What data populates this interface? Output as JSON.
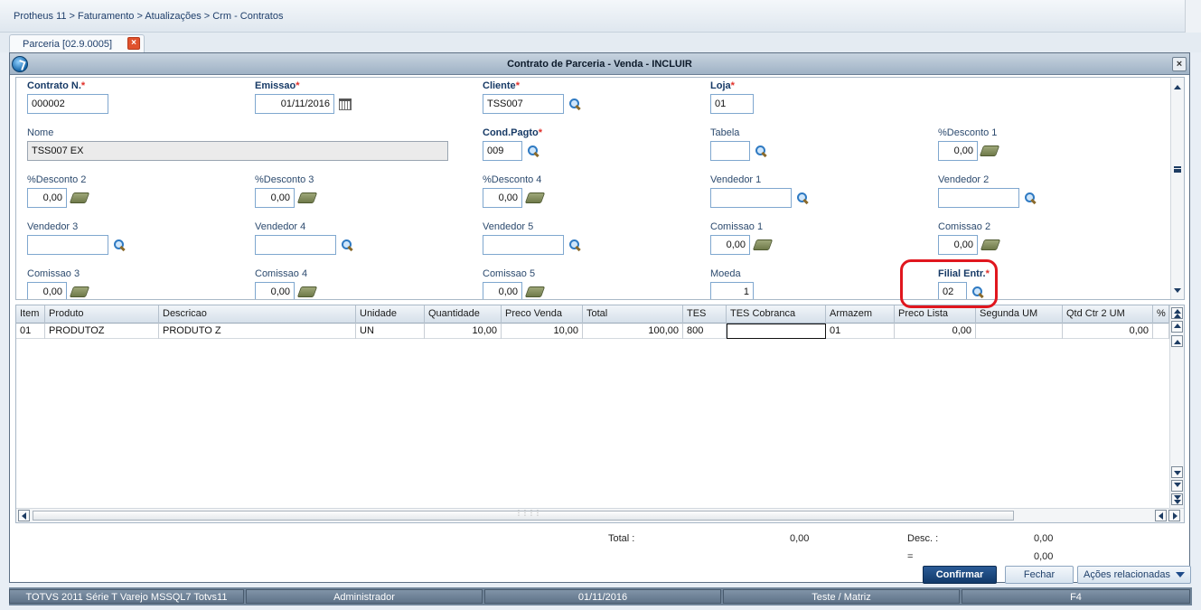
{
  "breadcrumb": "Protheus 11 > Faturamento > Atualizações > Crm - Contratos",
  "tab": {
    "label": "Parceria [02.9.0005]",
    "close": "×"
  },
  "window": {
    "title": "Contrato de Parceria - Venda - INCLUIR",
    "close": "×"
  },
  "form": {
    "contrato": {
      "label": "Contrato N.",
      "value": "000002"
    },
    "emissao": {
      "label": "Emissao",
      "value": "01/11/2016"
    },
    "cliente": {
      "label": "Cliente",
      "value": "TSS007"
    },
    "loja": {
      "label": "Loja",
      "value": "01"
    },
    "nome": {
      "label": "Nome",
      "value": "TSS007 EX"
    },
    "cond_pagto": {
      "label": "Cond.Pagto",
      "value": "009"
    },
    "tabela": {
      "label": "Tabela",
      "value": ""
    },
    "desconto1": {
      "label": "%Desconto 1",
      "value": "0,00"
    },
    "desconto2": {
      "label": "%Desconto 2",
      "value": "0,00"
    },
    "desconto3": {
      "label": "%Desconto 3",
      "value": "0,00"
    },
    "desconto4": {
      "label": "%Desconto 4",
      "value": "0,00"
    },
    "vendedor1": {
      "label": "Vendedor 1",
      "value": ""
    },
    "vendedor2": {
      "label": "Vendedor 2",
      "value": ""
    },
    "vendedor3": {
      "label": "Vendedor 3",
      "value": ""
    },
    "vendedor4": {
      "label": "Vendedor 4",
      "value": ""
    },
    "vendedor5": {
      "label": "Vendedor 5",
      "value": ""
    },
    "comissao1": {
      "label": "Comissao 1",
      "value": "0,00"
    },
    "comissao2": {
      "label": "Comissao 2",
      "value": "0,00"
    },
    "comissao3": {
      "label": "Comissao 3",
      "value": "0,00"
    },
    "comissao4": {
      "label": "Comissao 4",
      "value": "0,00"
    },
    "comissao5": {
      "label": "Comissao 5",
      "value": "0,00"
    },
    "moeda": {
      "label": "Moeda",
      "value": "1"
    },
    "filial_entr": {
      "label": "Filial Entr.",
      "value": "02"
    },
    "required_mark": "*"
  },
  "grid": {
    "headers": [
      "Item",
      "Produto",
      "Descricao",
      "Unidade",
      "Quantidade",
      "Preco Venda",
      "Total",
      "TES",
      "TES Cobranca",
      "Armazem",
      "Preco Lista",
      "Segunda UM",
      "Qtd Ctr 2 UM",
      "%"
    ],
    "rows": [
      [
        "01",
        "PRODUTOZ",
        "PRODUTO Z",
        "UN",
        "10,00",
        "10,00",
        "100,00",
        "800",
        "",
        "01",
        "0,00",
        "",
        "0,00",
        ""
      ]
    ]
  },
  "totals": {
    "total_label": "Total :",
    "total_value": "0,00",
    "desc_label": "Desc. :",
    "desc_value": "0,00",
    "eq_label": "=",
    "eq_value": "0,00"
  },
  "buttons": {
    "confirm": "Confirmar",
    "close": "Fechar",
    "actions": "Ações relacionadas"
  },
  "status": {
    "system": "TOTVS 2011 Série T Varejo MSSQL7 Totvs11",
    "user": "Administrador",
    "date": "01/11/2016",
    "company": "Teste / Matriz",
    "key": "F4"
  }
}
